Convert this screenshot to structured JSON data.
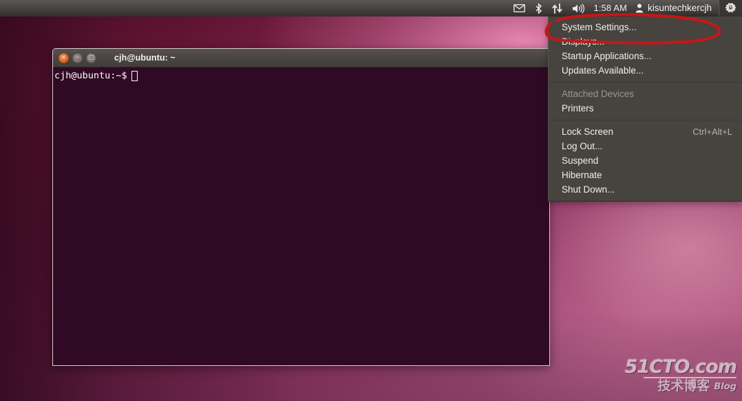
{
  "panel": {
    "indicators": [
      {
        "name": "messaging-icon",
        "label": "Messaging"
      },
      {
        "name": "bluetooth-icon",
        "label": "Bluetooth"
      },
      {
        "name": "network-icon",
        "label": "Network"
      },
      {
        "name": "volume-icon",
        "label": "Volume"
      }
    ],
    "clock": "1:58 AM",
    "user_icon": "user-icon",
    "username": "kisuntechkercjh",
    "session_icon": "session-gear-power-icon",
    "background_color": "#4a4745"
  },
  "terminal": {
    "title": "cjh@ubuntu: ~",
    "buttons": {
      "close": "×",
      "minimize": "−",
      "maximize": "□"
    },
    "prompt": "cjh@ubuntu:~$",
    "background_color": "#300a24",
    "text_color": "#ffffff"
  },
  "session_menu": {
    "background_color": "#47433f",
    "groups": [
      {
        "items": [
          {
            "label": "System Settings...",
            "accel": "",
            "disabled": false,
            "highlighted": true
          },
          {
            "label": "Displays...",
            "accel": "",
            "disabled": false,
            "highlighted": false
          },
          {
            "label": "Startup Applications...",
            "accel": "",
            "disabled": false,
            "highlighted": false
          },
          {
            "label": "Updates Available...",
            "accel": "",
            "disabled": false,
            "highlighted": false
          }
        ]
      },
      {
        "items": [
          {
            "label": "Attached Devices",
            "accel": "",
            "disabled": true,
            "highlighted": false
          },
          {
            "label": "Printers",
            "accel": "",
            "disabled": false,
            "highlighted": false
          }
        ]
      },
      {
        "items": [
          {
            "label": "Lock Screen",
            "accel": "Ctrl+Alt+L",
            "disabled": false,
            "highlighted": false
          },
          {
            "label": "Log Out...",
            "accel": "",
            "disabled": false,
            "highlighted": false
          },
          {
            "label": "Suspend",
            "accel": "",
            "disabled": false,
            "highlighted": false
          },
          {
            "label": "Hibernate",
            "accel": "",
            "disabled": false,
            "highlighted": false
          },
          {
            "label": "Shut Down...",
            "accel": "",
            "disabled": false,
            "highlighted": false
          }
        ]
      }
    ]
  },
  "annotation": {
    "name": "red-ellipse-highlight",
    "color": "#c31818",
    "target": "System Settings..."
  },
  "watermark": {
    "main": "51CTO.com",
    "chinese": "技术博客",
    "blog": "Blog"
  }
}
